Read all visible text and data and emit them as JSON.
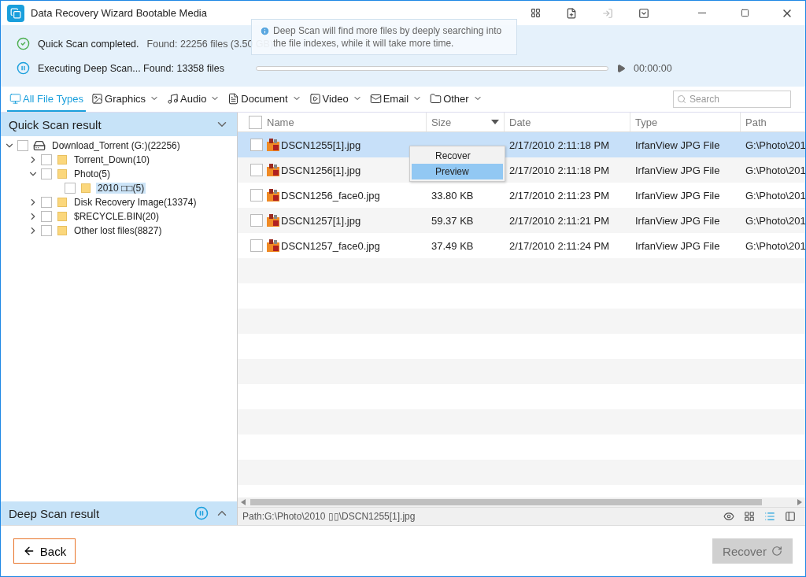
{
  "window": {
    "title": "Data Recovery Wizard Bootable Media"
  },
  "status": {
    "quick": {
      "label": "Quick Scan completed.",
      "found": "Found: 22256 files (3.50 GB)"
    },
    "deep": {
      "label": "Executing Deep Scan... Found: 13358 files",
      "level": 0,
      "time": "00:00:00"
    }
  },
  "tooltip": {
    "text": "Deep Scan will find more files by deeply searching into the file indexes, while it will take more time."
  },
  "file_types": [
    {
      "label": "All File Types",
      "selected": true
    },
    {
      "label": "Graphics",
      "selected": false
    },
    {
      "label": "Audio",
      "selected": false
    },
    {
      "label": "Document",
      "selected": false
    },
    {
      "label": "Video",
      "selected": false
    },
    {
      "label": "Email",
      "selected": false
    },
    {
      "label": "Other",
      "selected": false
    }
  ],
  "search": {
    "placeholder": "Search"
  },
  "quick_scan": {
    "title": "Quick Scan result",
    "expanded": true,
    "tree": [
      {
        "label": "Download_Torrent (G:)(22256)",
        "kind": "drive",
        "expanded": true,
        "checked": false,
        "selected": false,
        "children": [
          {
            "label": "Torrent_Down(10)",
            "kind": "folder",
            "expanded": false,
            "checked": false,
            "selected": false
          },
          {
            "label": "Photo(5)",
            "kind": "folder",
            "expanded": true,
            "checked": false,
            "selected": false,
            "children": [
              {
                "label": "2010 □□(5)",
                "kind": "folder",
                "checked": false,
                "selected": true
              }
            ]
          },
          {
            "label": "Disk Recovery Image(13374)",
            "kind": "folder",
            "expanded": false,
            "checked": false,
            "selected": false
          },
          {
            "label": "$RECYCLE.BIN(20)",
            "kind": "folder",
            "expanded": false,
            "checked": false,
            "selected": false
          },
          {
            "label": "Other lost files(8827)",
            "kind": "folder",
            "expanded": false,
            "checked": false,
            "selected": false
          }
        ]
      }
    ]
  },
  "deep_scan": {
    "title": "Deep Scan result",
    "expanded": false
  },
  "table": {
    "columns": [
      {
        "label": "Name",
        "sorted": false
      },
      {
        "label": "Size",
        "sorted": true
      },
      {
        "label": "Date",
        "sorted": false
      },
      {
        "label": "Type",
        "sorted": false
      },
      {
        "label": "Path",
        "sorted": false
      }
    ],
    "select_all": {
      "checked": false
    },
    "rows": [
      {
        "name": "DSCN1255[1].jpg",
        "date": "2/17/2010 2:11:18 PM",
        "type": "IrfanView JPG File",
        "path": "G:\\Photo\\201",
        "selected": true,
        "checked": false
      },
      {
        "name": "DSCN1256[1].jpg",
        "date": "2/17/2010 2:11:18 PM",
        "type": "IrfanView JPG File",
        "path": "G:\\Photo\\201",
        "selected": false,
        "checked": false
      },
      {
        "name": "DSCN1256_face0.jpg",
        "size": "33.80 KB",
        "date": "2/17/2010 2:11:23 PM",
        "type": "IrfanView JPG File",
        "path": "G:\\Photo\\201",
        "selected": false,
        "checked": false
      },
      {
        "name": "DSCN1257[1].jpg",
        "size": "59.37 KB",
        "date": "2/17/2010 2:11:21 PM",
        "type": "IrfanView JPG File",
        "path": "G:\\Photo\\201",
        "selected": false,
        "checked": false
      },
      {
        "name": "DSCN1257_face0.jpg",
        "size": "37.49 KB",
        "date": "2/17/2010 2:11:24 PM",
        "type": "IrfanView JPG File",
        "path": "G:\\Photo\\201",
        "selected": false,
        "checked": false
      }
    ]
  },
  "context_menu": [
    {
      "label": "Recover",
      "selected": false
    },
    {
      "label": "Preview",
      "selected": true
    }
  ],
  "path_bar": {
    "text": "Path:G:\\Photo\\2010 ▯▯\\DSCN1255[1].jpg"
  },
  "views": [
    {
      "selected": false
    },
    {
      "selected": false
    },
    {
      "selected": true
    },
    {
      "selected": false
    }
  ],
  "footer": {
    "back": "Back",
    "recover": {
      "label": "Recover",
      "disabled": true
    }
  }
}
